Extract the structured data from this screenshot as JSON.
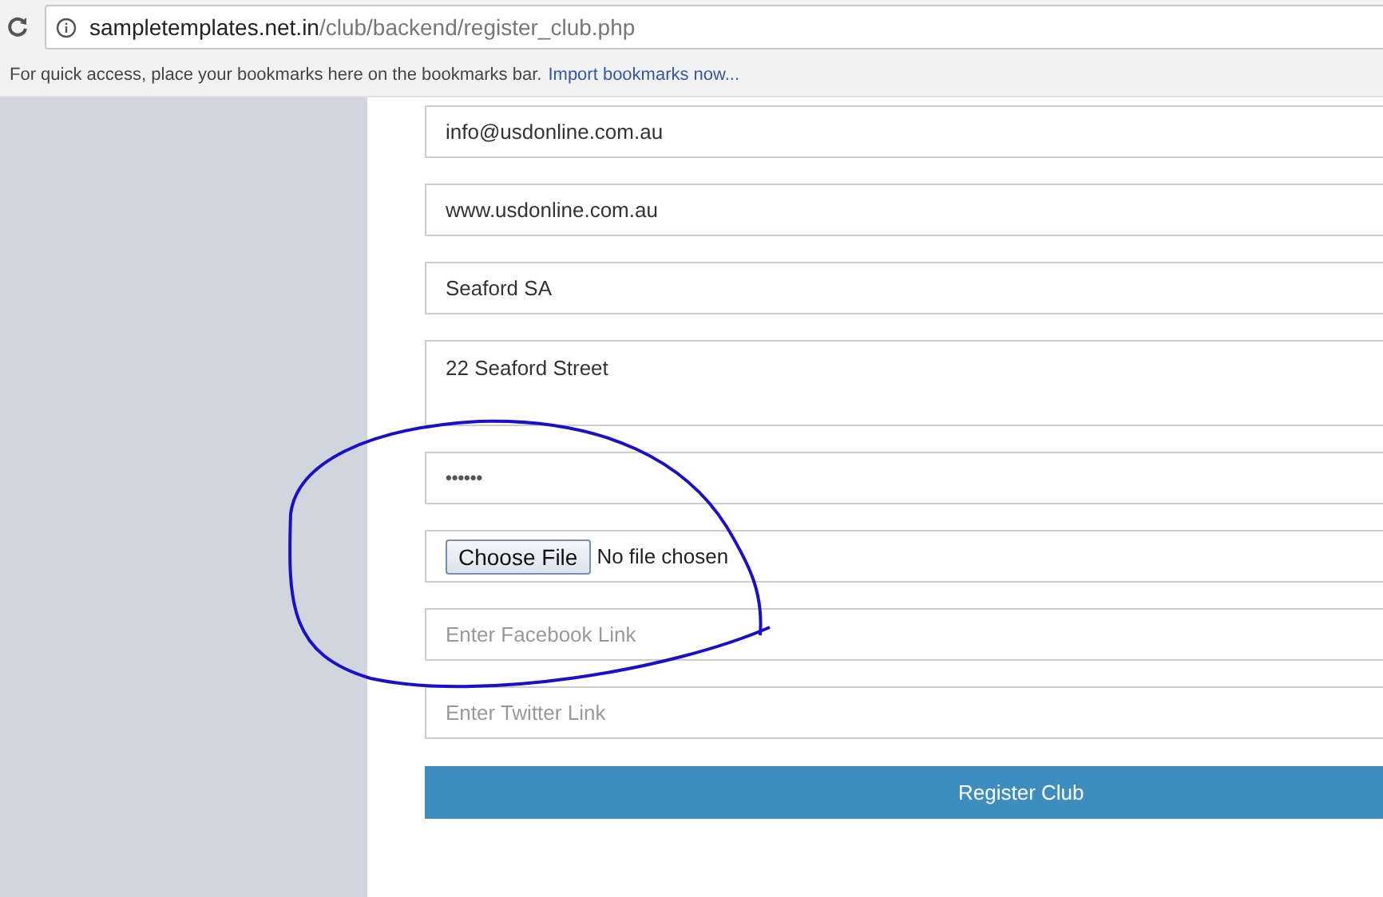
{
  "browser": {
    "url_host": "sampletemplates.net.in",
    "url_path": "/club/backend/register_club.php",
    "bookmarks_hint": "For quick access, place your bookmarks here on the bookmarks bar.",
    "bookmarks_link": "Import bookmarks now..."
  },
  "form": {
    "fields": [
      {
        "kind": "text",
        "value": "info@usdonline.com.au"
      },
      {
        "kind": "text",
        "value": "www.usdonline.com.au"
      },
      {
        "kind": "text",
        "value": "Seaford SA"
      },
      {
        "kind": "textarea",
        "value": "22 Seaford Street"
      },
      {
        "kind": "password",
        "value": "••••••"
      },
      {
        "kind": "file",
        "button": "Choose File",
        "status": "No file chosen"
      },
      {
        "kind": "text",
        "placeholder": "Enter Facebook Link"
      },
      {
        "kind": "text",
        "placeholder": "Enter Twitter Link"
      }
    ],
    "submit": "Register Club"
  }
}
